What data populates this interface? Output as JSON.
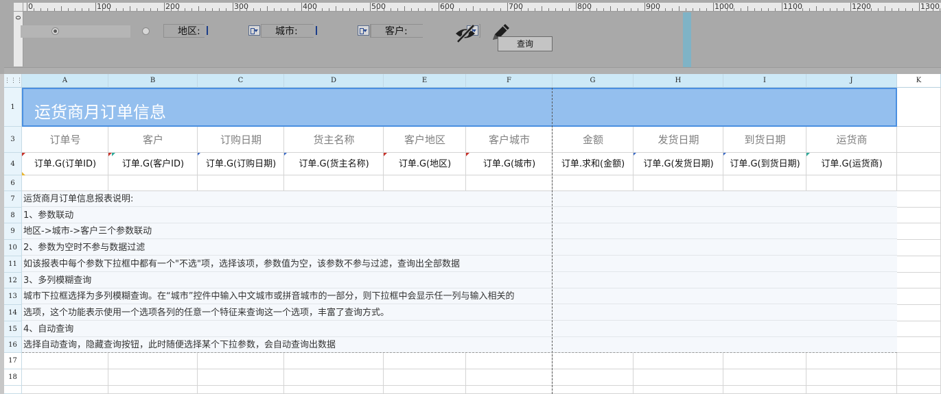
{
  "ruler": {
    "marks": [
      "0",
      "100",
      "200",
      "300",
      "400",
      "500",
      "600",
      "700",
      "800",
      "900",
      "1000",
      "1100",
      "1200",
      "1300"
    ],
    "vertical_mark": "0"
  },
  "params": {
    "region_label": "地区:",
    "city_label": "城市:",
    "customer_label": "客户:",
    "query_button": "查询",
    "radio_options": 2,
    "icons": {
      "hide": "eye-off-icon",
      "edit": "pencil-icon"
    }
  },
  "sheet": {
    "columns": [
      "A",
      "B",
      "C",
      "D",
      "E",
      "F",
      "G",
      "H",
      "I",
      "J",
      "K"
    ],
    "corner_glyph": "⋮⋮⋮",
    "rows": {
      "r1": "1",
      "r3": "3",
      "r4": "4",
      "r6": "6",
      "r7": "7",
      "r8": "8",
      "r9": "9",
      "r10": "10",
      "r11": "11",
      "r12": "12",
      "r13": "13",
      "r14": "14",
      "r15": "15",
      "r16": "16",
      "r17": "17",
      "r18": "18"
    },
    "title": "运货商月订单信息",
    "headers": [
      "订单号",
      "客户",
      "订购日期",
      "货主名称",
      "客户地区",
      "客户城市",
      "金额",
      "发货日期",
      "到货日期",
      "运货商"
    ],
    "fields": [
      "订单.G(订单ID)",
      "订单.G(客户ID)",
      "订单.G(订购日期)",
      "订单.G(货主名称)",
      "订单.G(地区)",
      "订单.G(城市)",
      "订单.求和(金额)",
      "订单.G(发货日期)",
      "订单.G(到货日期)",
      "订单.G(运货商)"
    ],
    "description": [
      "运货商月订单信息报表说明:",
      "1、参数联动",
      "  地区->城市->客户三个参数联动",
      "2、参数为空时不参与数据过滤",
      "  如该报表中每个参数下拉框中都有一个\"不选\"项，选择该项，参数值为空，该参数不参与过滤，查询出全部数据",
      "3、多列模糊查询",
      "  城市下拉框选择为多列模糊查询。在“城市”控件中输入中文城市或拼音城市的一部分，则下拉框中会显示任一列与输入相关的",
      "  选项，这个功能表示使用一个选项各列的任意一个特征来查询这一个选项，丰富了查询方式。",
      "4、自动查询",
      "  选择自动查询，隐藏查询按钮，此时随便选择某个下拉参数，会自动查询出数据"
    ]
  },
  "colors": {
    "title_bg": "#94bfee",
    "title_border": "#4a8fe0",
    "header_text": "#7f7f7f",
    "panel_bg": "#a9a9a9"
  }
}
